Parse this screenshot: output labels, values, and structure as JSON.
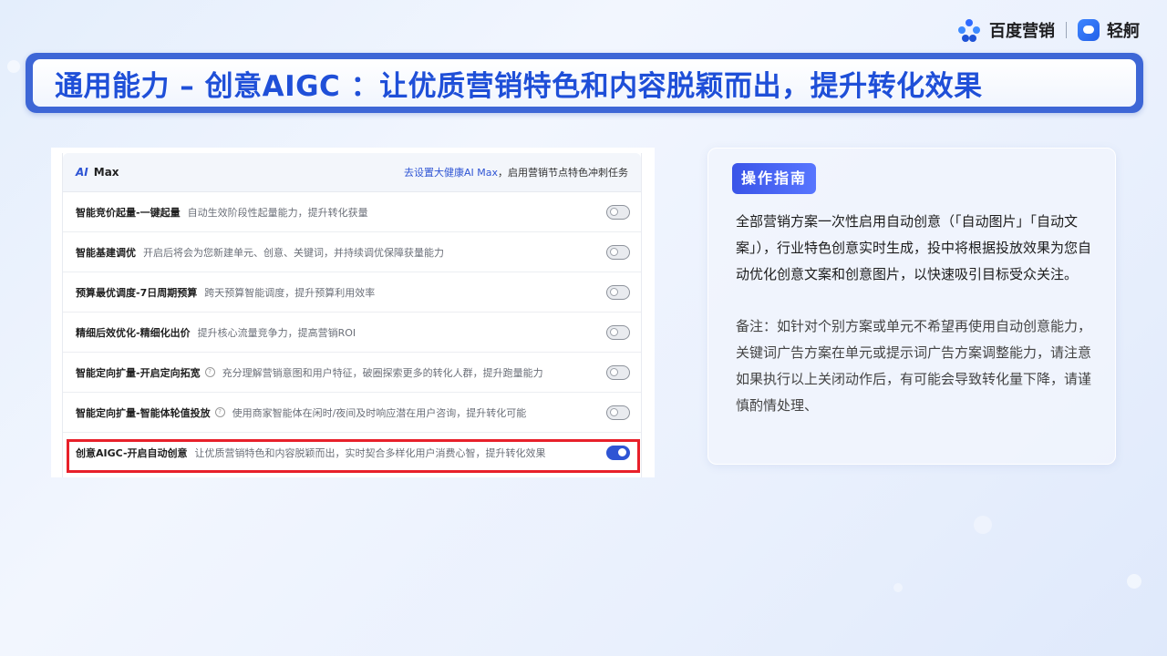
{
  "logos": {
    "baidu_marketing": "百度营销",
    "qingzhou": "轻舸"
  },
  "title": "通用能力 – 创意AIGC ：让优质营销特色和内容脱颖而出，提升转化效果",
  "panel": {
    "brand_ai": "AI",
    "brand_name": "Max",
    "head_link": "去设置大健康AI Max",
    "head_suffix": "，启用营销节点特色冲刺任务",
    "rows": [
      {
        "title": "智能竞价起量-一键起量",
        "help": false,
        "desc": "自动生效阶段性起量能力，提升转化获量",
        "enabled": false
      },
      {
        "title": "智能基建调优",
        "help": false,
        "desc": "开启后将会为您新建单元、创意、关键词，并持续调优保障获量能力",
        "enabled": false
      },
      {
        "title": "预算最优调度-7日周期预算",
        "help": false,
        "desc": "跨天预算智能调度，提升预算利用效率",
        "enabled": false
      },
      {
        "title": "精细后效优化-精细化出价",
        "help": false,
        "desc": "提升核心流量竞争力，提高营销ROI",
        "enabled": false
      },
      {
        "title": "智能定向扩量-开启定向拓宽",
        "help": true,
        "desc": "充分理解营销意图和用户特征，破圈探索更多的转化人群，提升跑量能力",
        "enabled": false
      },
      {
        "title": "智能定向扩量-智能体轮值投放",
        "help": true,
        "desc": "使用商家智能体在闲时/夜间及时响应潜在用户咨询，提升转化可能",
        "enabled": false
      },
      {
        "title": "创意AIGC-开启自动创意",
        "help": false,
        "desc": "让优质营销特色和内容脱颖而出，实时契合多样化用户消费心智，提升转化效果",
        "enabled": true
      }
    ]
  },
  "guide": {
    "tag": "操作指南",
    "body": "全部营销方案一次性启用自动创意（「自动图片」「自动文案」），行业特色创意实时生成，投中将根据投放效果为您自动优化创意文案和创意图片，以快速吸引目标受众关注。",
    "note": "备注：如针对个别方案或单元不希望再使用自动创意能力，关键词广告方案在单元或提示词广告方案调整能力，请注意如果执行以上关闭动作后，有可能会导致转化量下降，请谨慎酌情处理、"
  },
  "colors": {
    "accent": "#2f55d4",
    "title_text": "#1f4fd8",
    "title_frame": "#3d66d6",
    "highlight": "#e8202a"
  }
}
